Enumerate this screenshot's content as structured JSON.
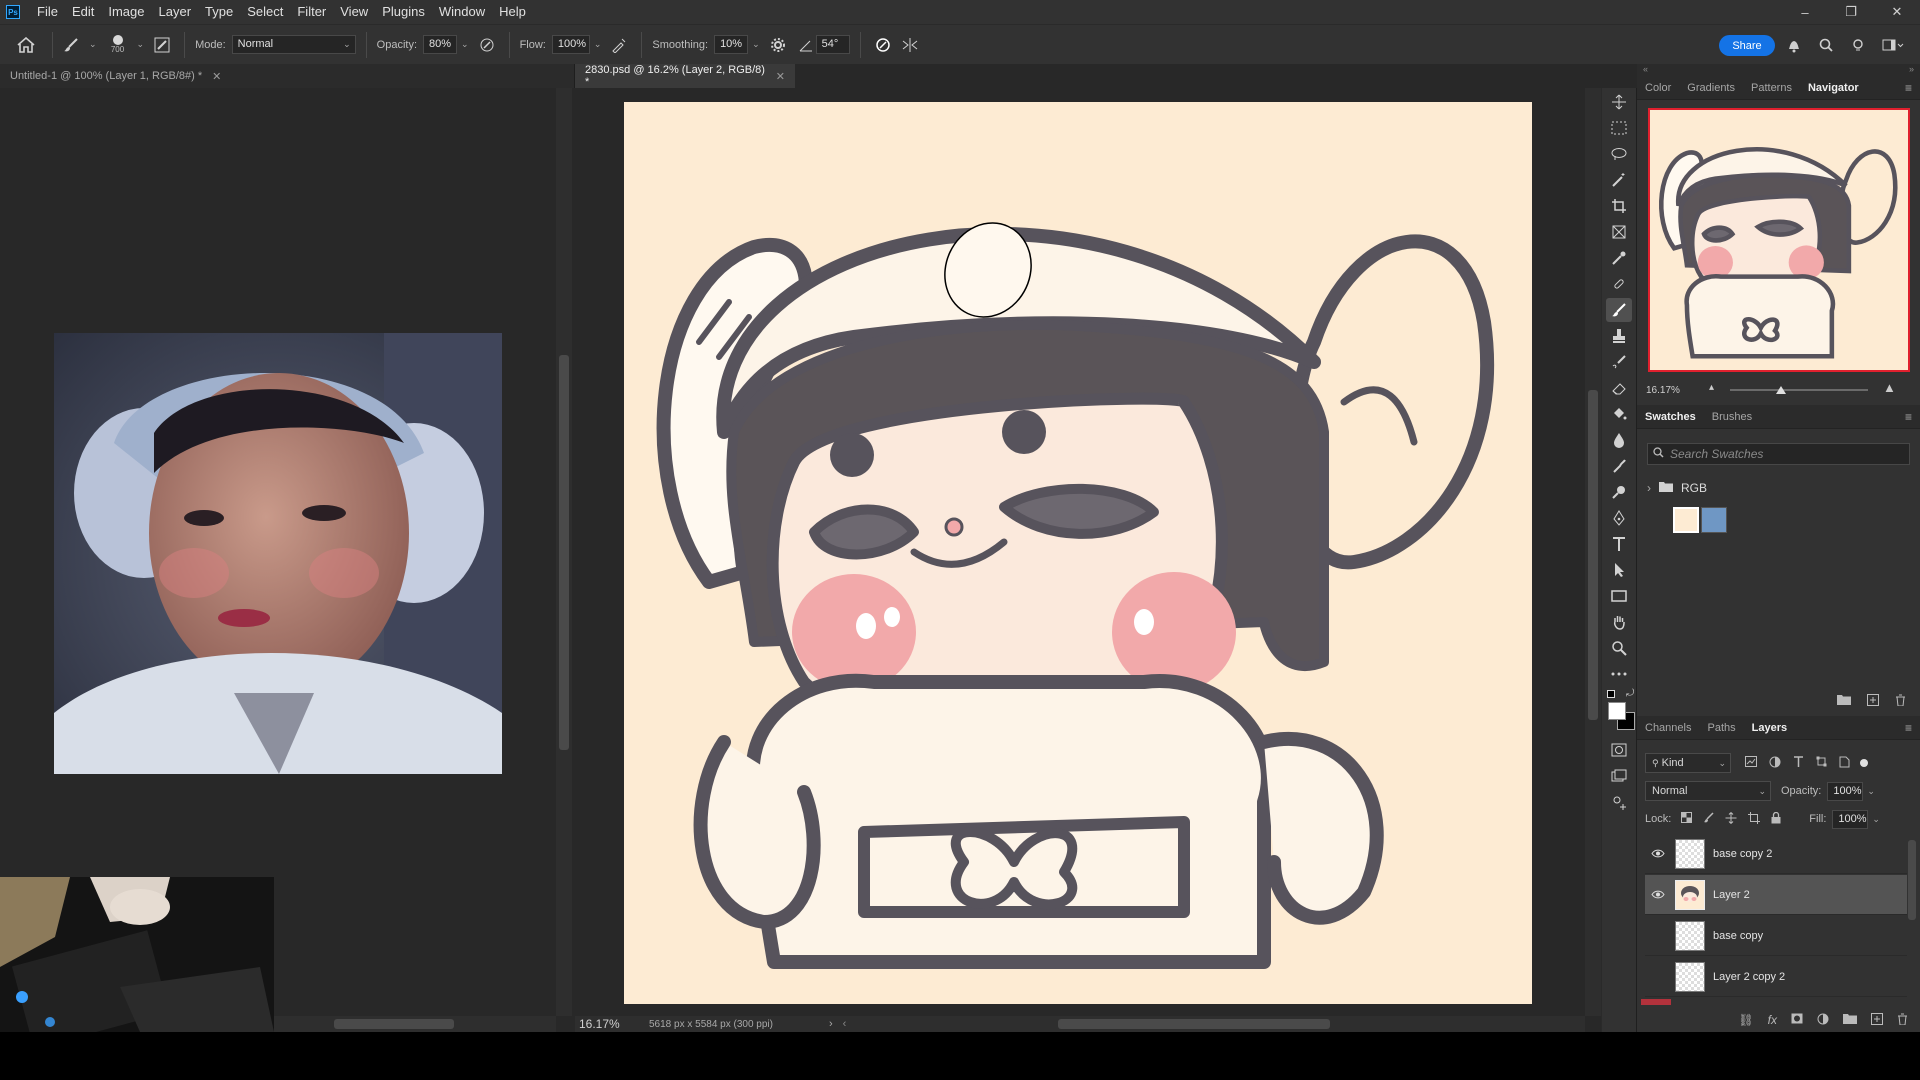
{
  "app": {
    "logo": "Ps"
  },
  "menu": [
    "File",
    "Edit",
    "Image",
    "Layer",
    "Type",
    "Select",
    "Filter",
    "View",
    "Plugins",
    "Window",
    "Help"
  ],
  "window_controls": {
    "minimize": "–",
    "restore": "❐",
    "close": "✕"
  },
  "options_bar": {
    "brush_size": "700",
    "mode_label": "Mode:",
    "mode_value": "Normal",
    "opacity_label": "Opacity:",
    "opacity_value": "80%",
    "flow_label": "Flow:",
    "flow_value": "100%",
    "smoothing_label": "Smoothing:",
    "smoothing_value": "10%",
    "angle_value": "54°",
    "share_label": "Share"
  },
  "documents": {
    "tab1_title": "Untitled-1 @ 100% (Layer 1, RGB/8#) *",
    "tab2_title": "2830.psd @ 16.2% (Layer 2, RGB/8) *",
    "zoom": "16.17%",
    "doc_info": "5618 px x 5584 px (300 ppi)"
  },
  "panels": {
    "top_tabs": [
      "Color",
      "Gradients",
      "Patterns",
      "Navigator"
    ],
    "top_active": "Navigator",
    "navigator_zoom": "16.17%",
    "swatch_tabs": [
      "Swatches",
      "Brushes"
    ],
    "swatch_active": "Swatches",
    "swatch_search_placeholder": "Search Swatches",
    "swatch_group": "RGB",
    "swatch_colors": [
      "#fdebd3",
      "#6f97c4"
    ],
    "layer_tabs": [
      "Channels",
      "Paths",
      "Layers"
    ],
    "layer_active": "Layers",
    "filter_kind": "Kind",
    "blend_mode": "Normal",
    "opacity_label": "Opacity:",
    "opacity_value": "100%",
    "lock_label": "Lock:",
    "fill_label": "Fill:",
    "fill_value": "100%",
    "layers": [
      {
        "name": "base copy 2",
        "visible": true,
        "selected": false
      },
      {
        "name": "Layer 2",
        "visible": true,
        "selected": true
      },
      {
        "name": "base copy",
        "visible": false,
        "selected": false
      },
      {
        "name": "Layer 2 copy 2",
        "visible": false,
        "selected": false
      }
    ]
  },
  "colors": {
    "accent": "#1473e6",
    "canvas": "#fdebd3",
    "selection": "#545454",
    "navigator_frame": "#e0202e"
  },
  "icons": {
    "home": "home-icon",
    "brush": "brush-icon",
    "settings": "gear-icon",
    "search": "search-icon",
    "bell": "bell-icon",
    "folder": "folder-icon",
    "eye": "eye-icon"
  }
}
